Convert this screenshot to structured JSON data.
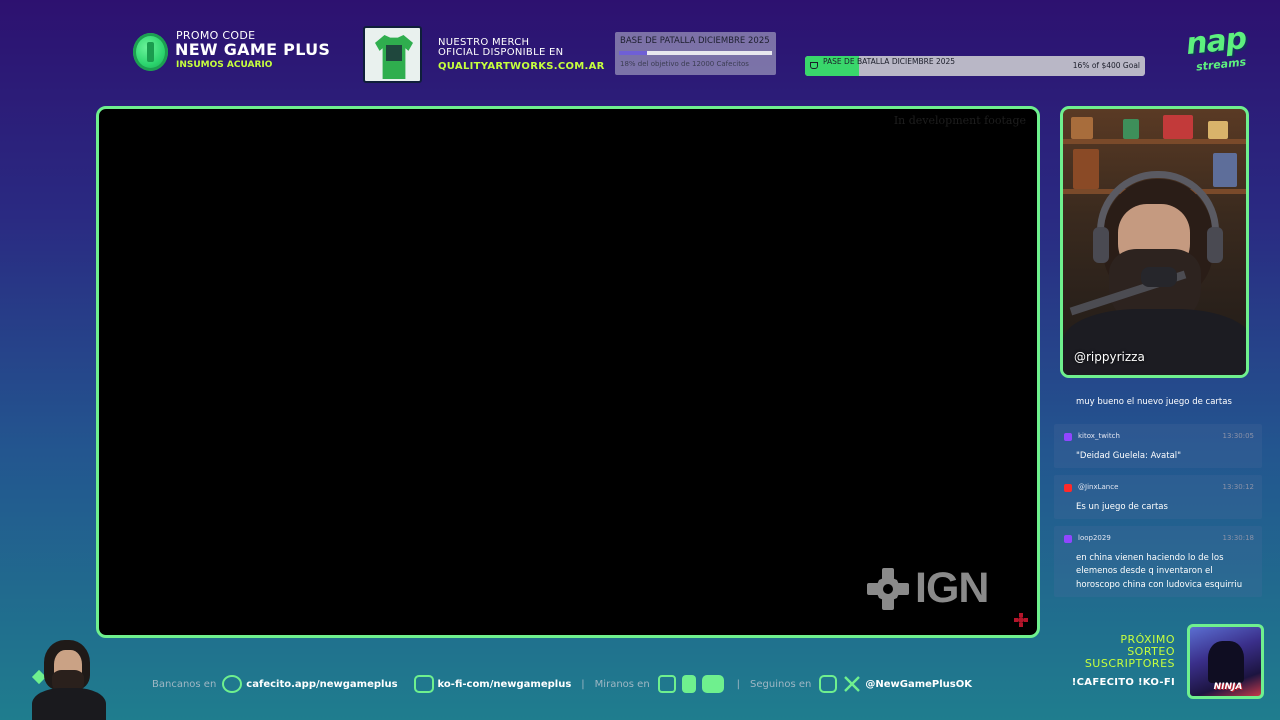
{
  "header": {
    "promo": {
      "label": "PROMO CODE",
      "code": "NEW GAME PLUS",
      "sponsor": "INSUMOS ACUARIO"
    },
    "merch": {
      "line1": "NUESTRO MERCH",
      "line2": "OFICIAL DISPONIBLE EN",
      "site": "QUALITYARTWORKS.COM.AR"
    },
    "goal_cafecito": {
      "title": "BASE DE PATALLA DICIEMBRE 2025",
      "subtitle": "18% del objetivo de 12000 Cafecitos",
      "progress_pct": 18
    },
    "goal_kofi": {
      "title": "PASE DE BATALLA DICIEMBRE 2025",
      "progress_text": "16% of $400 Goal",
      "progress_pct": 16
    },
    "logo": {
      "main": "nap",
      "sub": "streams"
    }
  },
  "video": {
    "watermark": "In development footage",
    "ign_text": "IGN",
    "ign_icon": "ign-logo-icon"
  },
  "webcam": {
    "handle": "@rippyrizza"
  },
  "chat": {
    "top_text": "muy bueno el nuevo juego de cartas",
    "messages": [
      {
        "platform": "twitch",
        "user": "kitox_twitch",
        "time": "13:30:05",
        "text": "\"Deidad Guelela: Avatal\"",
        "icon_color": "#9146ff"
      },
      {
        "platform": "youtube",
        "user": "@JinxLance",
        "time": "13:30:12",
        "text": "Es un juego de cartas",
        "icon_color": "#ff2a2a"
      },
      {
        "platform": "twitch",
        "user": "loop2029",
        "time": "13:30:18",
        "text": "en china vienen haciendo lo de los elemenos desde q inventaron el horoscopo china con ludovica esquirriu",
        "icon_color": "#9146ff"
      }
    ]
  },
  "bottom": {
    "bancanos_label": "Bancanos en",
    "cafecito_link": "cafecito.app/newgameplus",
    "kofi_link": "ko-fi-com/newgameplus",
    "miranos_label": "Miranos en",
    "seguinos_label": "Seguinos en",
    "social_handle": "@NewGamePlusOK",
    "separator": "|",
    "icons": [
      "cafecito-icon",
      "kofi-icon",
      "twitch-icon",
      "kick-icon",
      "youtube-icon",
      "instagram-icon",
      "x-icon"
    ]
  },
  "sorteo": {
    "line1": "PRÓXIMO",
    "line2": "SORTEO",
    "line3": "SUSCRIPTORES",
    "commands": "!CAFECITO !KO-FI",
    "prize_title": "NINJA"
  },
  "colors": {
    "accent_green": "#6ff08e",
    "lime": "#c6ff3d",
    "video_bg": "#000000"
  }
}
